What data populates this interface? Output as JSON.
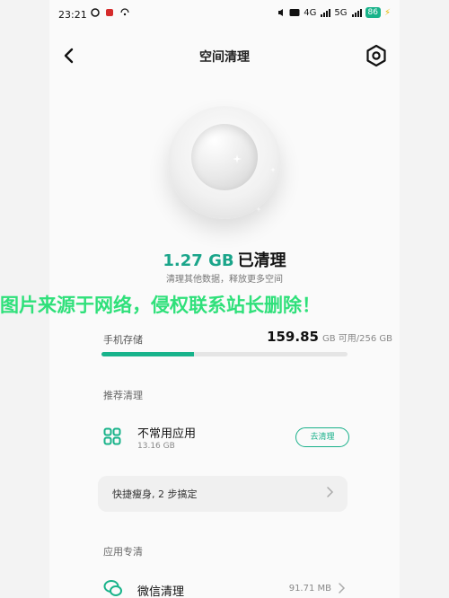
{
  "status": {
    "time": "23:21",
    "network_4g": "4G",
    "network_5g": "5G",
    "battery": "86"
  },
  "header": {
    "title": "空间清理"
  },
  "hero": {
    "cleaned_size": "1.27 GB",
    "cleaned_suffix": "已清理",
    "subtitle": "清理其他数据，释放更多空间"
  },
  "watermark": "图片来源于网络，侵权联系站长删除！",
  "storage": {
    "label": "手机存储",
    "available": "159.85",
    "unit": "GB 可用/256 GB",
    "used_fraction": 0.376
  },
  "recommend": {
    "section_title": "推荐清理",
    "app_name": "不常用应用",
    "app_size": "13.16 GB",
    "button": "去清理"
  },
  "shortcut": {
    "text": "快捷瘦身, 2 步搞定"
  },
  "app_clean": {
    "section_title": "应用专清",
    "wechat_name": "微信清理",
    "wechat_size": "91.71 MB"
  },
  "colors": {
    "accent": "#19b38a",
    "watermark": "#2fe07a"
  }
}
